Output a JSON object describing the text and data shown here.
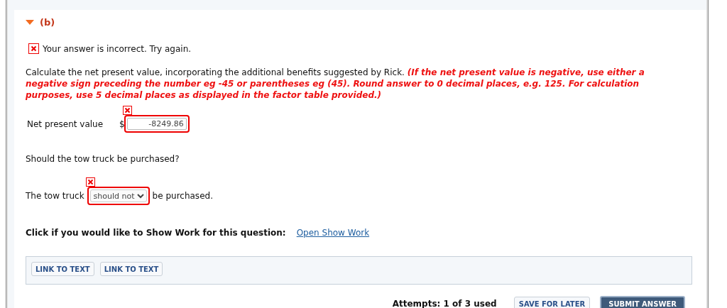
{
  "part": {
    "label": "(b)",
    "expanded": true
  },
  "feedback": {
    "correct": false,
    "text": "Your answer is incorrect.  Try again."
  },
  "instructions": {
    "text": "Calculate the net present value, incorporating the additional benefits suggested by Rick.",
    "hint": "(If the net present value is negative, use either a negative sign preceding the number eg -45 or parentheses eg (45). Round answer to 0 decimal places, e.g. 125. For calculation purposes, use 5 decimal places as displayed in the factor table provided.)"
  },
  "npv": {
    "label": "Net present value",
    "currency": "$",
    "value": "-8249.86",
    "correct": false
  },
  "question": "Should the tow truck be purchased?",
  "decision": {
    "before": "The tow truck",
    "value": "should not",
    "after": "be purchased.",
    "correct": false
  },
  "show_work": {
    "prompt": "Click if you would like to Show Work for this question:",
    "link": "Open Show Work"
  },
  "links": [
    "LINK TO TEXT",
    "LINK TO TEXT"
  ],
  "footer": {
    "attempts": "Attempts: 1 of 3 used",
    "save": "SAVE FOR LATER",
    "submit": "SUBMIT ANSWER"
  }
}
